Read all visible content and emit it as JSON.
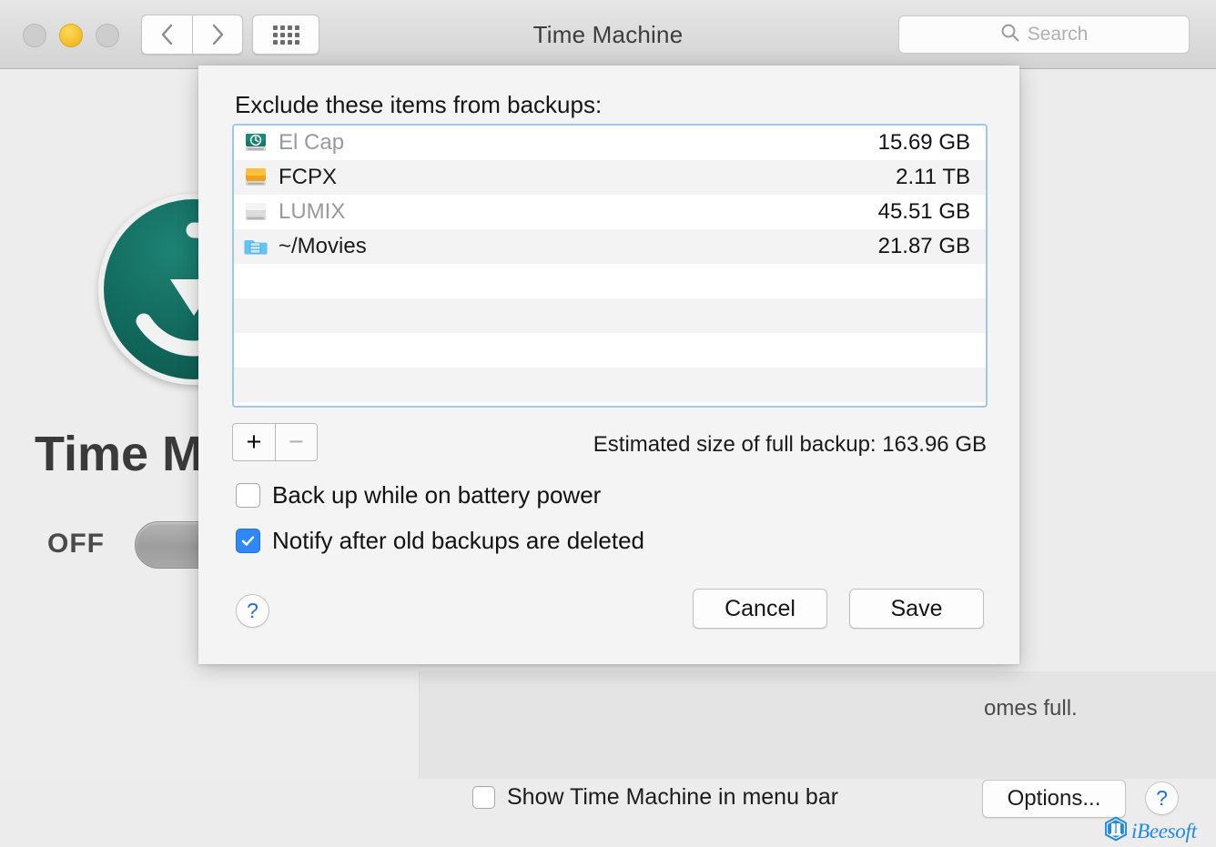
{
  "window": {
    "title": "Time Machine",
    "traffic_lights": [
      "close",
      "minimize",
      "maximize"
    ],
    "nav_back_icon": "chevron-left-icon",
    "nav_forward_icon": "chevron-right-icon",
    "grid_icon": "grid-all-preferences-icon"
  },
  "search": {
    "placeholder": "Search",
    "icon": "search-icon"
  },
  "background": {
    "heading": "Time M",
    "toggle_state_label": "OFF",
    "logo_icon": "time-machine-logo-icon",
    "truncated_text": "omes full.",
    "options_button": "Options...",
    "help_button": "?",
    "menu_bar_checkbox": {
      "label": "Show Time Machine in menu bar",
      "checked": false
    },
    "watermark": {
      "text": "iBeesoft",
      "icon": "ibeesoft-logo-icon"
    }
  },
  "sheet": {
    "title": "Exclude these items from backups:",
    "list": {
      "rows": [
        {
          "icon": "time-machine-disk-icon",
          "name": "El Cap",
          "size": "15.69 GB",
          "dimmed": true
        },
        {
          "icon": "orange-disk-icon",
          "name": "FCPX",
          "size": "2.11 TB",
          "dimmed": false
        },
        {
          "icon": "gray-disk-icon",
          "name": "LUMIX",
          "size": "45.51 GB",
          "dimmed": true
        },
        {
          "icon": "movies-folder-icon",
          "name": "~/Movies",
          "size": "21.87 GB",
          "dimmed": false
        }
      ],
      "empty_row_count": 4
    },
    "add_button": "+",
    "remove_button": "−",
    "estimated_size": "Estimated size of full backup: 163.96 GB",
    "checkboxes": [
      {
        "label": "Back up while on battery power",
        "checked": false
      },
      {
        "label": "Notify after old backups are deleted",
        "checked": true
      }
    ],
    "help_button": "?",
    "cancel_button": "Cancel",
    "save_button": "Save"
  },
  "colors": {
    "accent_blue": "#2f88f7",
    "list_focus_border": "#9ec7ef",
    "help_blue": "#1f6fe0",
    "time_machine_teal": "#126b5f",
    "disk_orange": "#f5a623",
    "folder_blue": "#5fc0f5",
    "watermark_blue": "#1b8ae8",
    "minimize_yellow": "#f7c032"
  }
}
